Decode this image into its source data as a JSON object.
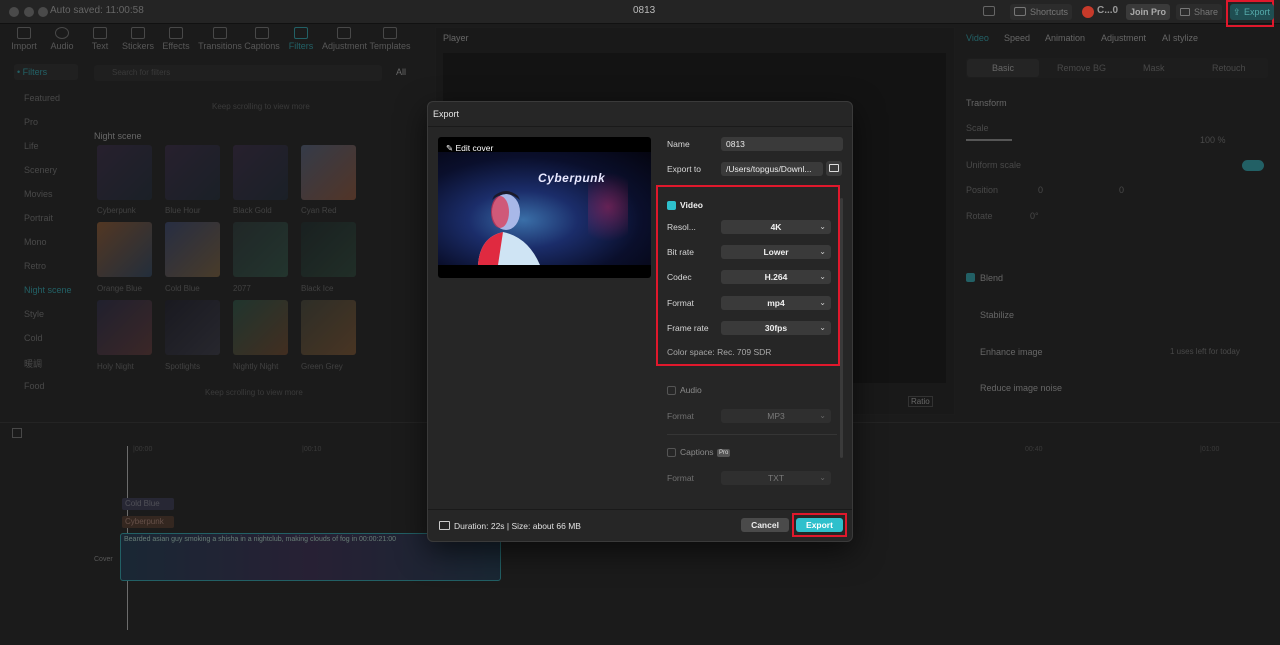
{
  "window": {
    "project_title": "0813",
    "autosave": "Auto saved: 11:00:58",
    "shortcuts_label": "Shortcuts",
    "user_label": "C...0",
    "join_pro_label": "Join Pro",
    "share_label": "Share",
    "export_label": "Export"
  },
  "toolbar": {
    "items": [
      "Import",
      "Audio",
      "Text",
      "Stickers",
      "Effects",
      "Transitions",
      "Captions",
      "Filters",
      "Adjustment",
      "Templates"
    ]
  },
  "left_nav": {
    "header": "• Filters",
    "search_placeholder": "Search for filters",
    "all_label": "All",
    "items": [
      "Featured",
      "Pro",
      "Life",
      "Scenery",
      "Movies",
      "Portrait",
      "Mono",
      "Retro",
      "Night scene",
      "Style",
      "Cold",
      "暖調",
      "Food"
    ],
    "hint_top": "Keep scrolling to view more",
    "section": "Night scene",
    "thumbs": [
      "Cyberpunk",
      "Blue Hour",
      "Black Gold",
      "Cyan Red",
      "Orange Blue",
      "Cold Blue",
      "2077",
      "Black Ice",
      "Holy Night",
      "Spotlights",
      "Nightly Night",
      "Green Grey"
    ],
    "hint_bottom": "Keep scrolling to view more"
  },
  "player": {
    "label": "Player",
    "ratio_label": "Ratio"
  },
  "right_panel": {
    "tabs": [
      "Video",
      "Speed",
      "Animation",
      "Adjustment",
      "AI stylize"
    ],
    "subtabs": [
      "Basic",
      "Remove BG",
      "Mask",
      "Retouch"
    ],
    "transform": "Transform",
    "scale": "Scale",
    "scale_value": "100 %",
    "uniform_scale": "Uniform scale",
    "position": "Position",
    "pos_x": "0",
    "pos_y": "0",
    "rotate": "Rotate",
    "rotate_value": "0°",
    "blend": "Blend",
    "stabilize": "Stabilize",
    "enhance_image": "Enhance image",
    "enhance_hint": "1 uses left for today",
    "reduce_noise": "Reduce image noise"
  },
  "timeline": {
    "time_a": "|00:00",
    "time_b": "|00:10",
    "time_c": "00:40",
    "time_d": "|01:00",
    "track_cold_blue": "Cold Blue",
    "track_cyberpunk": "Cyberpunk",
    "clip_title": "Bearded asian guy smoking a shisha in a nightclub, making clouds of fog in  00:00:21:00",
    "cover_label": "Cover"
  },
  "export_dialog": {
    "title": "Export",
    "edit_cover": "Edit cover",
    "cover_text": "Cyberpunk",
    "name_label": "Name",
    "name_value": "0813",
    "export_to_label": "Export to",
    "export_to_value": "/Users/topgus/Downl...",
    "video_section": "Video",
    "resolution_label": "Resol...",
    "resolution_value": "4K",
    "bitrate_label": "Bit rate",
    "bitrate_value": "Lower",
    "codec_label": "Codec",
    "codec_value": "H.264",
    "format_label": "Format",
    "format_value": "mp4",
    "framerate_label": "Frame rate",
    "framerate_value": "30fps",
    "color_space": "Color space: Rec. 709 SDR",
    "audio_section": "Audio",
    "audio_format_label": "Format",
    "audio_format_value": "MP3",
    "captions_section": "Captions",
    "captions_format_label": "Format",
    "captions_format_value": "TXT",
    "duration_info": "Duration: 22s | Size: about 66 MB",
    "cancel_label": "Cancel",
    "export_label": "Export",
    "pro_badge": "Pro"
  },
  "colors": {
    "accent": "#2ec0cc",
    "highlight_box": "#e0182c"
  }
}
